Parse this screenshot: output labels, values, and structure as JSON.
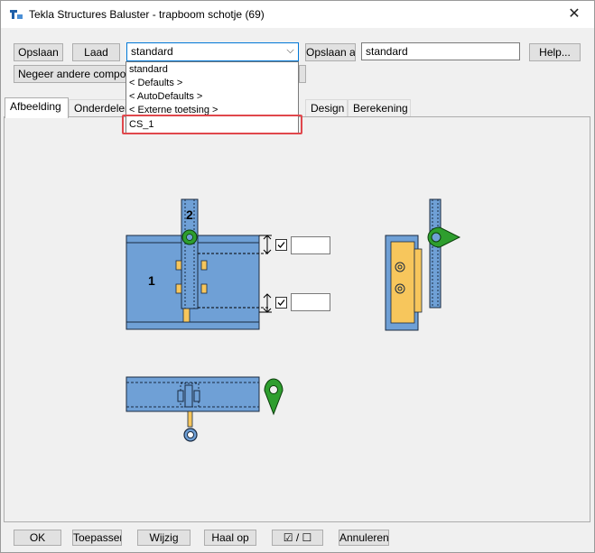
{
  "window": {
    "title": "Tekla Structures  Baluster - trapboom schotje (69)",
    "close_glyph": "✕"
  },
  "toolbar": {
    "save_label": "Opslaan",
    "load_label": "Laad",
    "preset_value": "standard",
    "save_as_label": "Opslaan al",
    "save_as_value": "standard",
    "help_label": "Help...",
    "ignore_components_label": "Negeer andere compon"
  },
  "preset_dropdown": {
    "options": [
      "standard",
      "< Defaults >",
      "< AutoDefaults >",
      "< Externe toetsing >",
      "CS_1"
    ],
    "highlighted": "CS_1"
  },
  "tabs": [
    {
      "label": "Afbeelding",
      "active": true
    },
    {
      "label": "Onderdelen",
      "active": false
    },
    {
      "label": "Design",
      "active": false
    },
    {
      "label": "Berekening",
      "active": false
    }
  ],
  "diagram": {
    "part_labels": [
      "2",
      "1"
    ],
    "beam_color": "#6fa0d6",
    "plate_color": "#f7c65c",
    "marker_color": "#2e9e2e"
  },
  "footer": {
    "ok_label": "OK",
    "apply_label": "Toepassen",
    "modify_label": "Wijzig",
    "get_label": "Haal op",
    "toggle_label": "☑ / ☐",
    "cancel_label": "Annuleren"
  },
  "icons": [
    "tekla-app-icon",
    "close-icon",
    "chevron-down-icon",
    "checkbox-icon",
    "direction-marker-icon"
  ]
}
